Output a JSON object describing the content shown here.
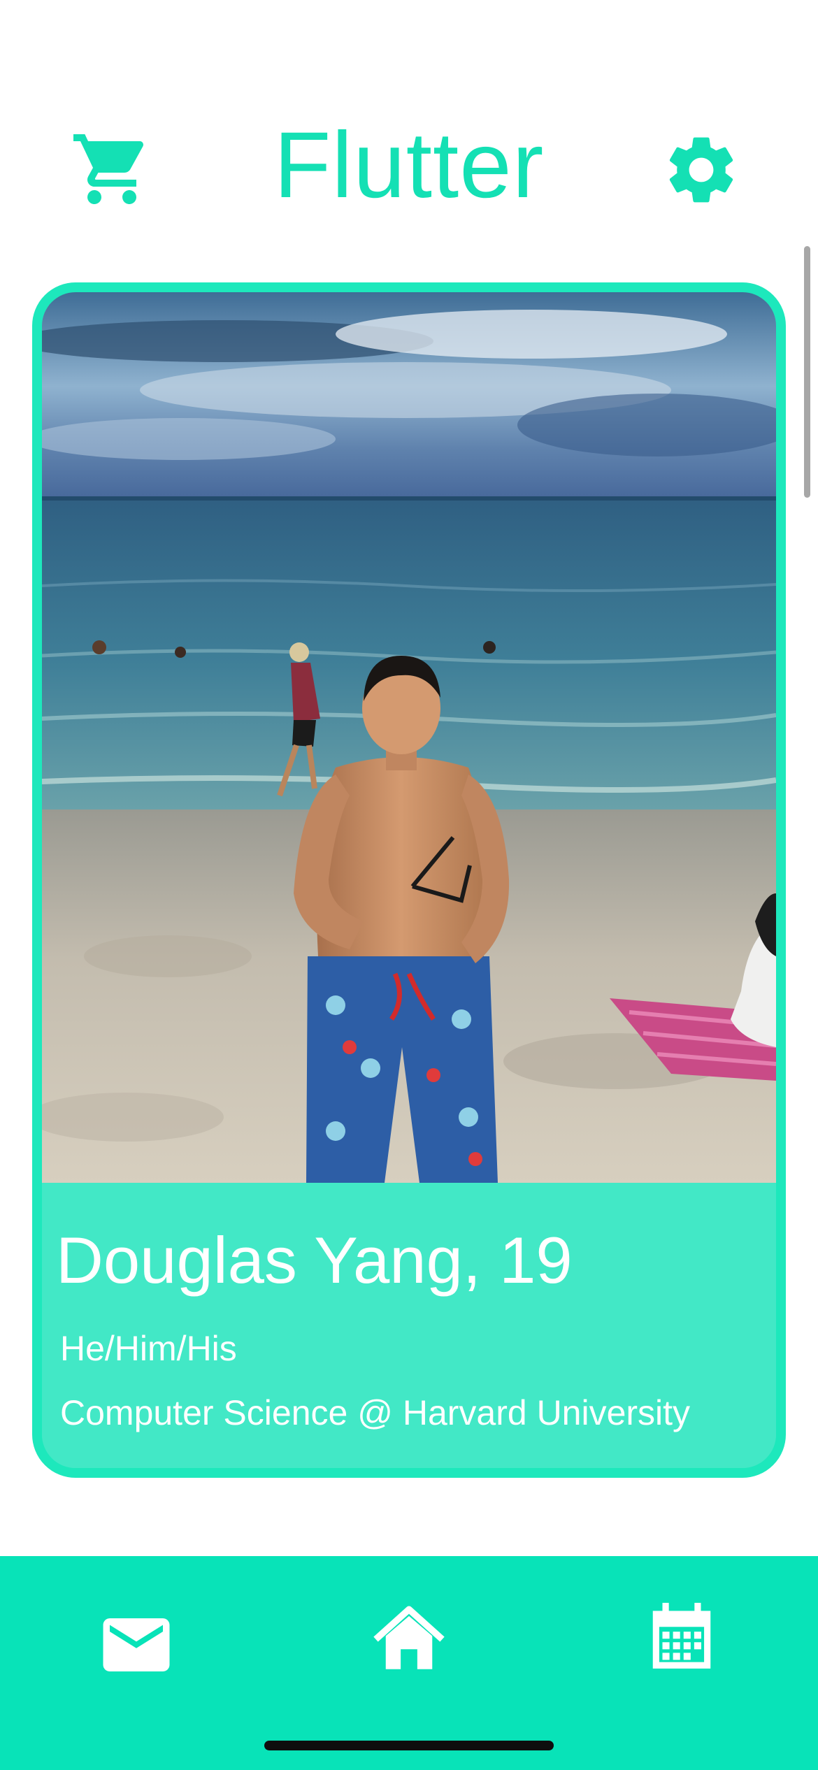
{
  "header": {
    "title": "Flutter",
    "cart_icon": "shopping-cart-icon",
    "settings_icon": "gear-icon"
  },
  "profile": {
    "name_age": "Douglas Yang, 19",
    "pronouns": "He/Him/His",
    "school": "Computer Science @ Harvard University",
    "photo": "beach-profile-photo"
  },
  "bottom_nav": {
    "items": [
      {
        "icon": "mail-icon"
      },
      {
        "icon": "home-icon"
      },
      {
        "icon": "calendar-icon"
      }
    ]
  },
  "colors": {
    "accent": "#14e0b4",
    "card_border": "#1de8bc",
    "card_fill": "#42e8c6",
    "nav_bar": "#08e3b8"
  }
}
